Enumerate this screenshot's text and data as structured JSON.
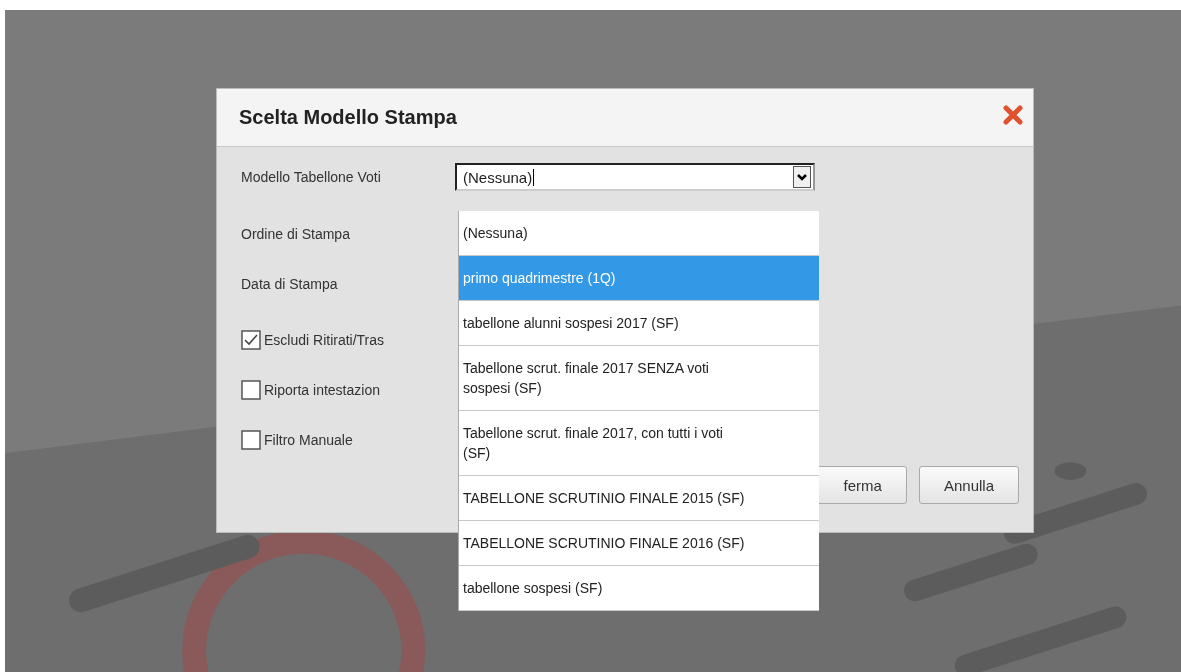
{
  "dialog": {
    "title": "Scelta Modello Stampa",
    "fields": [
      {
        "kind": "combo",
        "label": "Modello Tabellone Voti",
        "value": "(Nessuna)"
      },
      {
        "kind": "label",
        "label": "Ordine di Stampa"
      },
      {
        "kind": "label",
        "label": "Data di Stampa"
      }
    ],
    "checkboxes": [
      {
        "label": "Escludi Ritirati/Tras",
        "checked": true
      },
      {
        "label": "Riporta intestazion",
        "checked": false
      },
      {
        "label": "Filtro Manuale",
        "checked": false
      }
    ],
    "buttons": [
      "ferma",
      "Annulla"
    ]
  },
  "dropdown": {
    "options": [
      {
        "label": "(Nessuna)",
        "selected": false
      },
      {
        "label": "primo quadrimestre (1Q)",
        "selected": true
      },
      {
        "label": "tabellone alunni sospesi 2017 (SF)",
        "selected": false
      },
      {
        "label": "Tabellone scrut. finale 2017 SENZA voti sospesi (SF)",
        "selected": false
      },
      {
        "label": "Tabellone scrut. finale 2017, con tutti i voti (SF)",
        "selected": false
      },
      {
        "label": "TABELLONE SCRUTINIO FINALE 2015 (SF)",
        "selected": false
      },
      {
        "label": "TABELLONE SCRUTINIO FINALE 2016 (SF)",
        "selected": false
      },
      {
        "label": "tabellone sospesi (SF)",
        "selected": false
      }
    ]
  }
}
